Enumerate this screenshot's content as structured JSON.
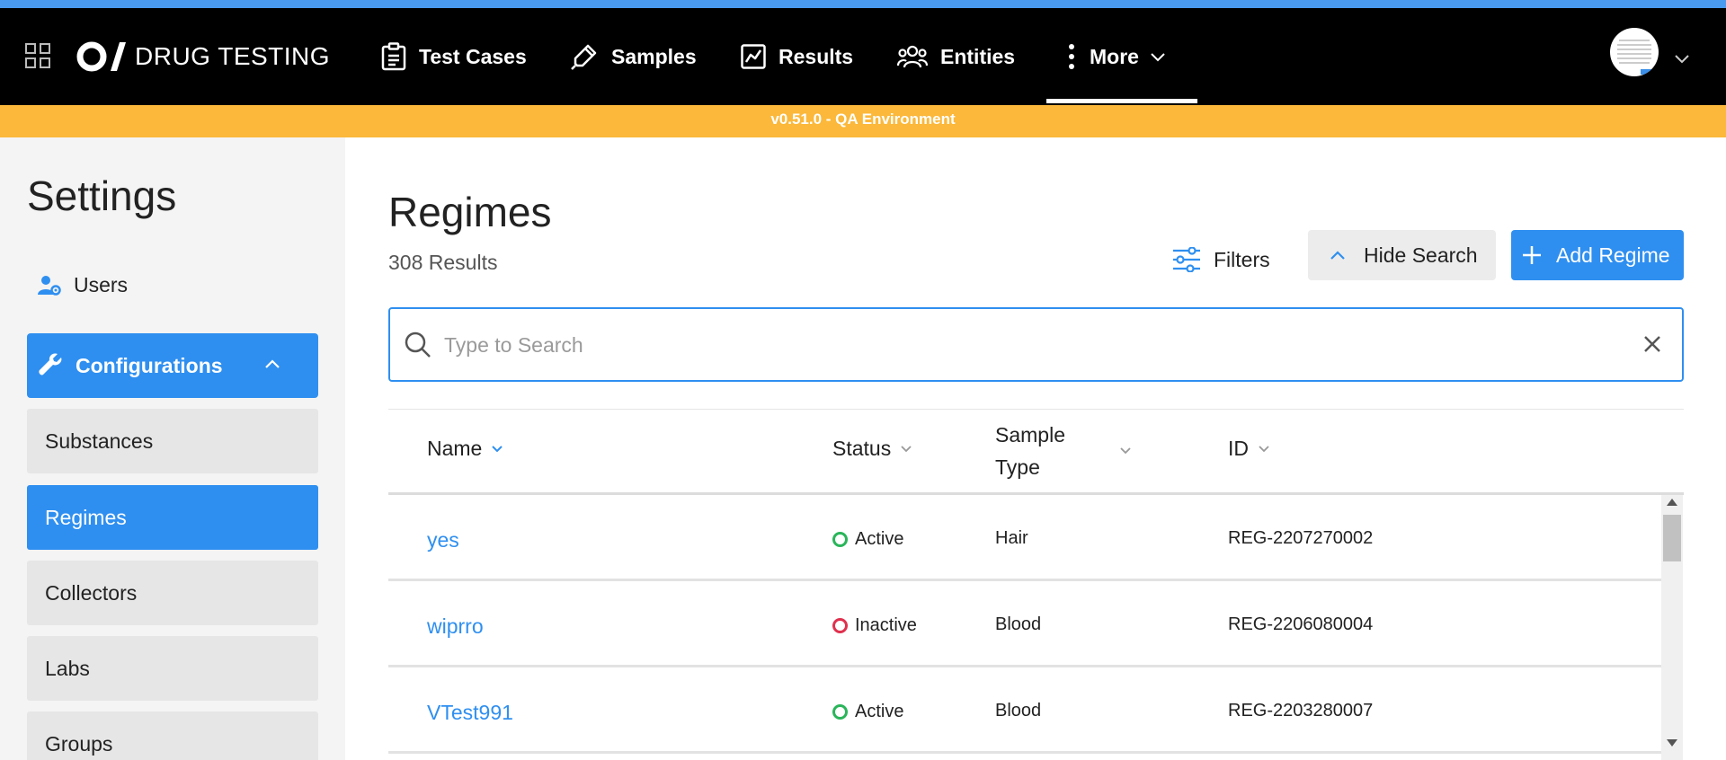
{
  "header": {
    "brand": "DRUG TESTING",
    "nav": [
      {
        "label": "Test Cases",
        "icon": "clipboard-icon"
      },
      {
        "label": "Samples",
        "icon": "pipette-icon"
      },
      {
        "label": "Results",
        "icon": "chart-icon"
      },
      {
        "label": "Entities",
        "icon": "people-icon"
      },
      {
        "label": "More",
        "icon": "kebab-icon"
      }
    ],
    "active_nav": "More"
  },
  "env_banner": "v0.51.0 - QA Environment",
  "sidebar": {
    "title": "Settings",
    "users_label": "Users",
    "configurations_label": "Configurations",
    "sub_items": [
      "Substances",
      "Regimes",
      "Collectors",
      "Labs",
      "Groups"
    ],
    "active_sub_item": "Regimes"
  },
  "main": {
    "title": "Regimes",
    "results_count": "308 Results",
    "filters_label": "Filters",
    "hide_search_label": "Hide Search",
    "add_label": "Add Regime",
    "search_placeholder": "Type to Search",
    "columns": {
      "name": "Name",
      "status": "Status",
      "sample_type": "Sample Type",
      "id": "ID"
    },
    "rows": [
      {
        "name": "yes",
        "status": "Active",
        "sample_type": "Hair",
        "id": "REG-2207270002"
      },
      {
        "name": "wiprro",
        "status": "Inactive",
        "sample_type": "Blood",
        "id": "REG-2206080004"
      },
      {
        "name": "VTest991",
        "status": "Active",
        "sample_type": "Blood",
        "id": "REG-2203280007"
      }
    ]
  },
  "colors": {
    "accent": "#2f8ff0",
    "top_strip": "#4a9bf0",
    "env_banner": "#fbb83a",
    "status_active": "#2ab55a",
    "status_inactive": "#e0304e"
  }
}
